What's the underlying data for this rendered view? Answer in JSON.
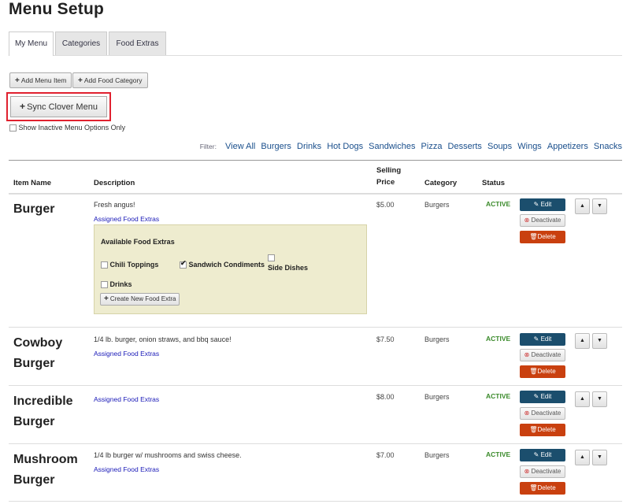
{
  "page": {
    "title": "Menu Setup"
  },
  "tabs": [
    {
      "label": "My Menu"
    },
    {
      "label": "Categories"
    },
    {
      "label": "Food Extras"
    }
  ],
  "toolbar": {
    "add_item_label": "Add Menu Item",
    "add_category_label": "Add Food Category",
    "sync_label": "Sync Clover Menu",
    "inactive_label": "Show Inactive Menu Options Only"
  },
  "filter": {
    "label": "Filter:",
    "options": [
      "View All",
      "Burgers",
      "Drinks",
      "Hot Dogs",
      "Sandwiches",
      "Pizza",
      "Desserts",
      "Soups",
      "Wings",
      "Appetizers",
      "Snacks"
    ]
  },
  "table": {
    "headers": {
      "item_name": "Item Name",
      "description": "Description",
      "selling_price_1": "Selling",
      "selling_price_2": "Price",
      "category": "Category",
      "status": "Status"
    },
    "rows": [
      {
        "name_1": "Burger",
        "name_2": "",
        "description": "Fresh angus!",
        "assigned": "Assigned Food Extras",
        "price": "$5.00",
        "category": "Burgers",
        "status": "ACTIVE"
      },
      {
        "name_1": "Cowboy",
        "name_2": "Burger",
        "description": "1/4 lb. burger, onion straws, and bbq sauce!",
        "assigned": "Assigned Food Extras",
        "price": "$7.50",
        "category": "Burgers",
        "status": "ACTIVE"
      },
      {
        "name_1": "Incredible",
        "name_2": "Burger",
        "description": "",
        "assigned": "Assigned Food Extras",
        "price": "$8.00",
        "category": "Burgers",
        "status": "ACTIVE"
      },
      {
        "name_1": "Mushroom",
        "name_2": "Burger",
        "description": "1/4 lb burger w/ mushrooms and swiss cheese.",
        "assigned": "Assigned Food Extras",
        "price": "$7.00",
        "category": "Burgers",
        "status": "ACTIVE"
      }
    ],
    "actions": {
      "edit": "Edit",
      "deactivate": "Deactivate",
      "delete": "Delete"
    }
  },
  "food_extras": {
    "title": "Available Food Extras",
    "options": [
      {
        "label": "Chili Toppings",
        "checked": false
      },
      {
        "label": "Sandwich Condiments",
        "checked": true
      },
      {
        "label": "Side Dishes",
        "checked": false
      },
      {
        "label": "Drinks",
        "checked": false
      }
    ],
    "create_label": "Create New Food Extra"
  },
  "colors": {
    "active_status": "#3a8a2a",
    "edit_button": "#1b4e6d",
    "delete_button": "#c9400f",
    "highlight_border": "#e0212f",
    "link": "#1a4f8c"
  }
}
